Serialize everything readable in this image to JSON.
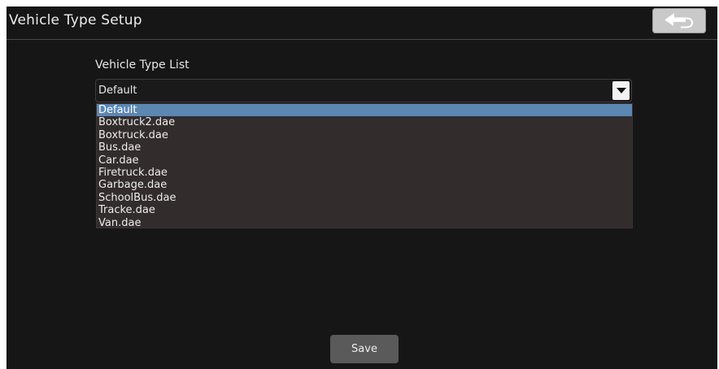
{
  "header": {
    "title": "Vehicle Type Setup",
    "back_icon": "back-arrow-icon"
  },
  "vehicle_type": {
    "label": "Vehicle Type List",
    "selected": "Default",
    "dropdown_icon": "chevron-down-icon",
    "options": [
      "Default",
      "Boxtruck2.dae",
      "Boxtruck.dae",
      "Bus.dae",
      "Car.dae",
      "Firetruck.dae",
      "Garbage.dae",
      "SchoolBus.dae",
      "Tracke.dae",
      "Van.dae"
    ],
    "selected_index": 0
  },
  "footer": {
    "save_label": "Save"
  },
  "colors": {
    "background": "#161616",
    "list_background": "#332c2c",
    "selection_highlight": "#5b87b3",
    "button_gray": "#5a5a5a",
    "back_button": "#c9c9c9"
  }
}
